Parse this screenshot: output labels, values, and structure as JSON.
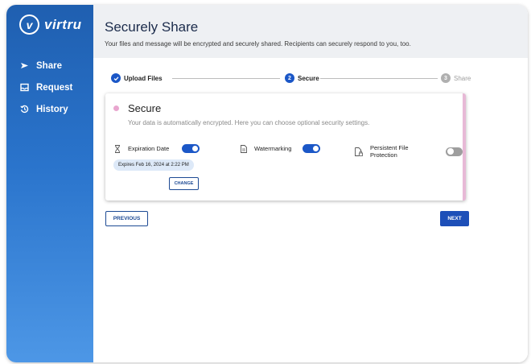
{
  "brand": {
    "logo_letter": "v",
    "name": "virtru"
  },
  "sidebar": {
    "items": [
      {
        "label": "Share",
        "icon": "send-icon"
      },
      {
        "label": "Request",
        "icon": "inbox-icon"
      },
      {
        "label": "History",
        "icon": "history-icon"
      }
    ]
  },
  "header": {
    "title": "Securely Share",
    "subtitle": "Your files and message will be encrypted and securely shared. Recipients can securely respond to you, too."
  },
  "stepper": {
    "steps": [
      {
        "label": "Upload Files",
        "number": "",
        "state": "complete"
      },
      {
        "label": "Secure",
        "number": "2",
        "state": "active"
      },
      {
        "label": "Share",
        "number": "3",
        "state": "inactive"
      }
    ]
  },
  "card": {
    "title": "Secure",
    "description": "Your data is automatically encrypted. Here you can choose optional security settings.",
    "options": [
      {
        "label": "Expiration Date",
        "icon": "hourglass-icon",
        "enabled": true
      },
      {
        "label": "Watermarking",
        "icon": "document-icon",
        "enabled": true
      },
      {
        "label": "Persistent File Protection",
        "icon": "file-lock-icon",
        "enabled": false
      }
    ],
    "expires_text": "Expires Feb 16, 2024 at 2:22 PM",
    "change_label": "CHANGE"
  },
  "actions": {
    "previous_label": "PREVIOUS",
    "next_label": "NEXT"
  },
  "colors": {
    "accent": "#1b57c7",
    "sidebar": "#2a74cc",
    "pink": "#e9a6cf"
  }
}
